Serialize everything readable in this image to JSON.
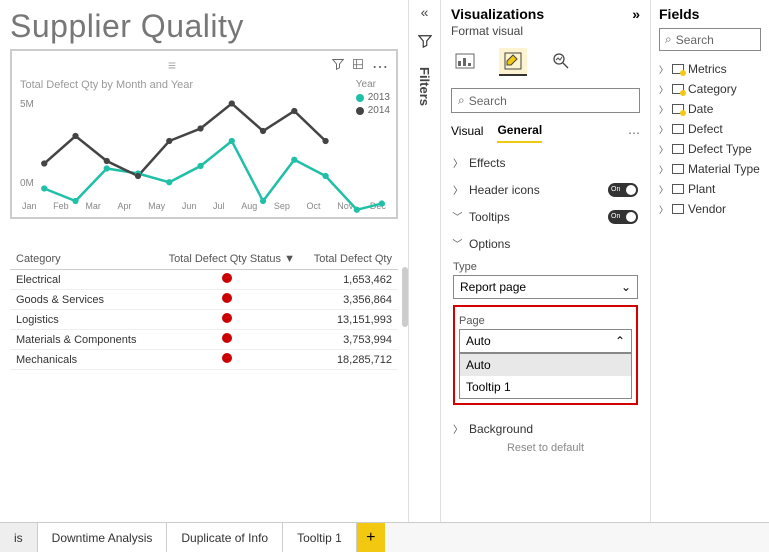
{
  "report_title": "Supplier Quality",
  "chart": {
    "title": "Total Defect Qty by Month and Year",
    "legend_title": "Year",
    "y_ticks": [
      "5M",
      "0M"
    ],
    "x_ticks": [
      "Jan",
      "Feb",
      "Mar",
      "Apr",
      "May",
      "Jun",
      "Jul",
      "Aug",
      "Sep",
      "Oct",
      "Nov",
      "Dec"
    ],
    "series": [
      {
        "name": "2013",
        "color": "#1fbfa8"
      },
      {
        "name": "2014",
        "color": "#444"
      }
    ]
  },
  "chart_data": {
    "type": "line",
    "title": "Total Defect Qty by Month and Year",
    "xlabel": "",
    "ylabel": "",
    "ylim": [
      0,
      6000000
    ],
    "categories": [
      "Jan",
      "Feb",
      "Mar",
      "Apr",
      "May",
      "Jun",
      "Jul",
      "Aug",
      "Sep",
      "Oct",
      "Nov",
      "Dec"
    ],
    "series": [
      {
        "name": "2013",
        "values": [
          1700000,
          1100000,
          2600000,
          2400000,
          2000000,
          2800000,
          3900000,
          1200000,
          3100000,
          2300000,
          800000,
          1100000
        ]
      },
      {
        "name": "2014",
        "values": [
          2800000,
          4000000,
          2900000,
          2300000,
          3800000,
          4400000,
          5600000,
          4300000,
          5200000,
          3900000,
          null,
          null
        ]
      }
    ]
  },
  "table": {
    "cols": [
      "Category",
      "Total Defect Qty Status",
      "Total Defect Qty"
    ],
    "sort_icon": "▼",
    "rows": [
      {
        "0": "Electrical",
        "1": "status",
        "2": "1,653,462"
      },
      {
        "0": "Goods & Services",
        "1": "status",
        "2": "3,356,864"
      },
      {
        "0": "Logistics",
        "1": "status",
        "2": "13,151,993"
      },
      {
        "0": "Materials & Components",
        "1": "status",
        "2": "3,753,994"
      },
      {
        "0": "Mechanicals",
        "1": "status",
        "2": "18,285,712"
      }
    ]
  },
  "filters_label": "Filters",
  "viz": {
    "title": "Visualizations",
    "subtitle": "Format visual",
    "search_placeholder": "Search",
    "tabs": {
      "visual": "Visual",
      "general": "General"
    },
    "sections": {
      "effects": "Effects",
      "headericons": "Header icons",
      "tooltips": "Tooltips",
      "options": "Options",
      "type_label": "Type",
      "type_value": "Report page",
      "page_label": "Page",
      "page_value": "Auto",
      "page_options": [
        "Auto",
        "Tooltip 1"
      ],
      "background": "Background",
      "reset": "Reset to default",
      "toggle_on": "On"
    }
  },
  "fields": {
    "title": "Fields",
    "search_placeholder": "Search",
    "items": [
      {
        "label": "Metrics",
        "y": true
      },
      {
        "label": "Category",
        "y": true
      },
      {
        "label": "Date",
        "y": true
      },
      {
        "label": "Defect",
        "y": false
      },
      {
        "label": "Defect Type",
        "y": false
      },
      {
        "label": "Material Type",
        "y": false
      },
      {
        "label": "Plant",
        "y": false
      },
      {
        "label": "Vendor",
        "y": false
      }
    ]
  },
  "tabstrip": {
    "items": [
      "is",
      "Downtime Analysis",
      "Duplicate of Info",
      "Tooltip 1"
    ],
    "plus": "+"
  }
}
